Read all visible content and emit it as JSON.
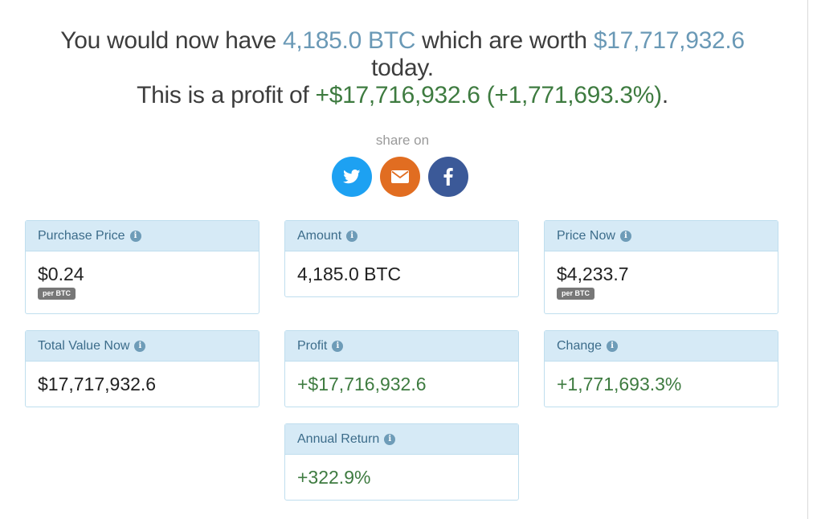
{
  "result": {
    "prefix": "You would now have",
    "amount": "4,185.0 BTC",
    "middle": "which are worth",
    "worth": "$17,717,932.6",
    "suffix": "today.",
    "profit_prefix": "This is a profit of",
    "profit": "+$17,716,932.6",
    "percent": "(+1,771,693.3%)",
    "end": "."
  },
  "share": {
    "label": "share on",
    "buttons": [
      {
        "name": "twitter",
        "icon": "twitter-icon",
        "color": "#1da1f2"
      },
      {
        "name": "email",
        "icon": "envelope-icon",
        "color": "#e16d21"
      },
      {
        "name": "facebook",
        "icon": "facebook-icon",
        "color": "#3b5998"
      }
    ]
  },
  "cards": {
    "purchase_price": {
      "title": "Purchase Price",
      "value": "$0.24",
      "unit": "per BTC"
    },
    "amount": {
      "title": "Amount",
      "value": "4,185.0 BTC"
    },
    "price_now": {
      "title": "Price Now",
      "value": "$4,233.7",
      "unit": "per BTC"
    },
    "total_value_now": {
      "title": "Total Value Now",
      "value": "$17,717,932.6"
    },
    "profit": {
      "title": "Profit",
      "value": "+$17,716,932.6"
    },
    "change": {
      "title": "Change",
      "value": "+1,771,693.3%"
    },
    "annual_return": {
      "title": "Annual Return",
      "value": "+322.9%"
    }
  },
  "colors": {
    "highlight_blue": "#6a99b6",
    "profit_green": "#3e7b40",
    "card_header_bg": "#d6eaf6"
  }
}
